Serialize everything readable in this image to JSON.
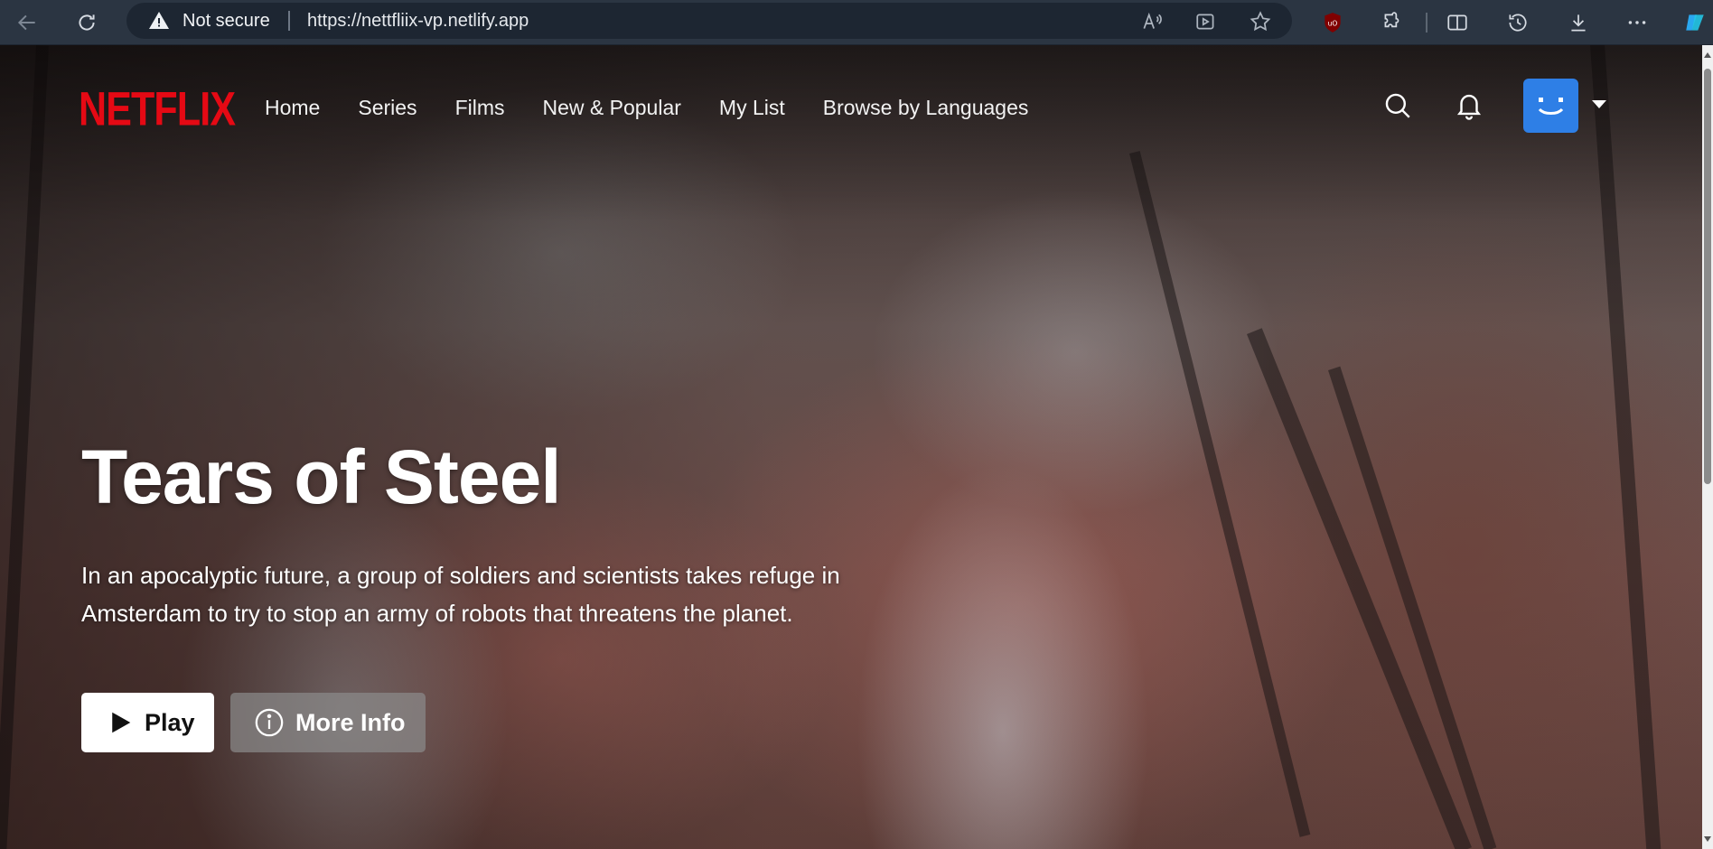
{
  "browser": {
    "security_label": "Not secure",
    "url": "https://nettfliix-vp.netlify.app",
    "icons": [
      "back-icon",
      "refresh-icon",
      "warning-icon",
      "read-aloud-icon",
      "immersive-reader-icon",
      "favorite-star-icon",
      "ublock-icon",
      "extensions-icon",
      "split-screen-icon",
      "history-icon",
      "downloads-icon",
      "more-icon",
      "copilot-icon"
    ]
  },
  "nav": {
    "logo": "NETFLIX",
    "links": [
      "Home",
      "Series",
      "Films",
      "New & Popular",
      "My List",
      "Browse by Languages"
    ]
  },
  "billboard": {
    "title": "Tears of Steel",
    "description": "In an apocalyptic future, a group of soldiers and scientists takes refuge in Amsterdam to try to stop an army of robots that threatens the planet.",
    "play_label": "Play",
    "info_label": "More Info"
  },
  "colors": {
    "brand": "#e50914",
    "avatar": "#2e7fe6",
    "chrome": "#2b3542"
  }
}
